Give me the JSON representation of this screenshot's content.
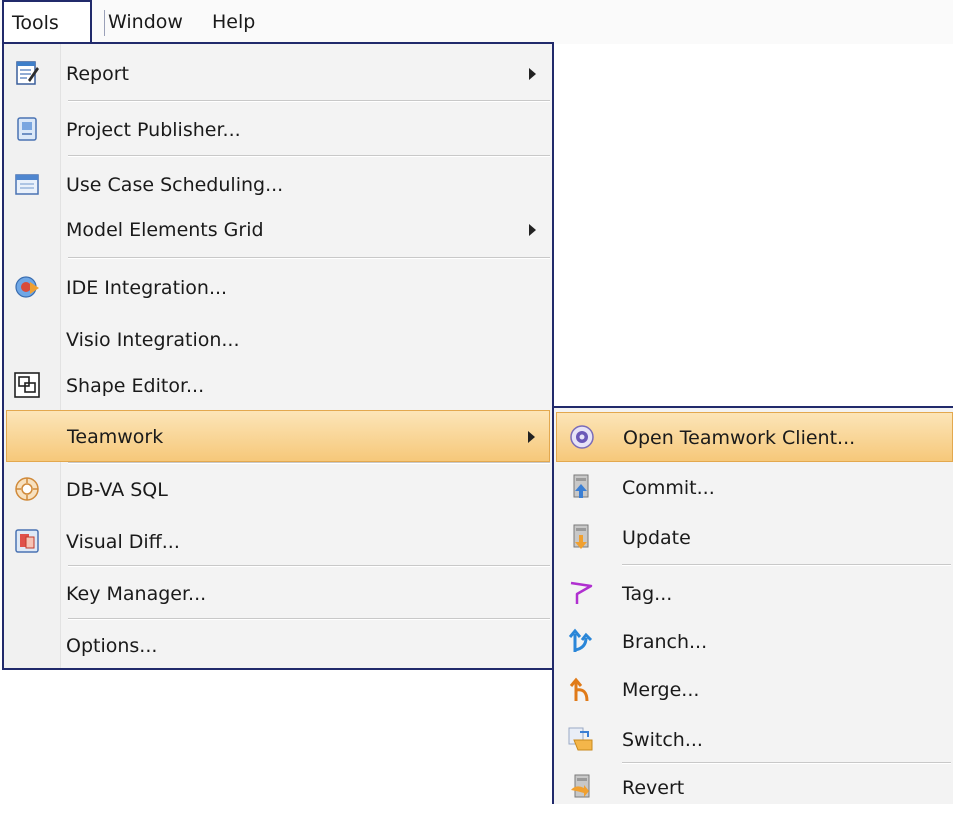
{
  "menubar": {
    "items": [
      {
        "label": "Tools"
      },
      {
        "label": "Window"
      },
      {
        "label": "Help"
      }
    ]
  },
  "tools_menu": {
    "items": [
      {
        "label": "Report",
        "icon": "report-icon",
        "submenu": true
      },
      {
        "label": "Project Publisher...",
        "icon": "publisher-icon"
      },
      {
        "label": "Use Case Scheduling...",
        "icon": "calendar-icon"
      },
      {
        "label": "Model Elements Grid",
        "icon": "",
        "submenu": true
      },
      {
        "label": "IDE Integration...",
        "icon": "ide-icon"
      },
      {
        "label": "Visio Integration...",
        "icon": ""
      },
      {
        "label": "Shape Editor...",
        "icon": "shape-editor-icon"
      },
      {
        "label": "Teamwork",
        "icon": "",
        "submenu": true,
        "highlighted": true
      },
      {
        "label": "DB-VA SQL",
        "icon": "database-icon"
      },
      {
        "label": "Visual Diff...",
        "icon": "visual-diff-icon"
      },
      {
        "label": "Key Manager...",
        "icon": ""
      },
      {
        "label": "Options...",
        "icon": ""
      }
    ]
  },
  "teamwork_submenu": {
    "items": [
      {
        "label": "Open Teamwork Client...",
        "icon": "teamwork-client-icon",
        "highlighted": true
      },
      {
        "label": "Commit...",
        "icon": "commit-icon"
      },
      {
        "label": "Update",
        "icon": "update-icon"
      },
      {
        "label": "Tag...",
        "icon": "tag-flag-icon"
      },
      {
        "label": "Branch...",
        "icon": "branch-icon"
      },
      {
        "label": "Merge...",
        "icon": "merge-icon"
      },
      {
        "label": "Switch...",
        "icon": "switch-icon"
      },
      {
        "label": "Revert",
        "icon": "revert-icon"
      }
    ]
  },
  "colors": {
    "menu_border": "#212a6b",
    "highlight_top": "#fce5b8",
    "highlight_bottom": "#f6c87a",
    "menu_bg": "#f3f3f3"
  }
}
